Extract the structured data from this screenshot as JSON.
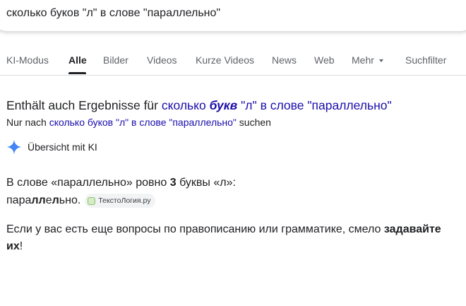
{
  "search": {
    "query": "сколько буков \"л\" в слове \"параллельно\""
  },
  "tabs": {
    "ki_modus": "KI-Modus",
    "alle": "Alle",
    "bilder": "Bilder",
    "videos": "Videos",
    "kurze_videos": "Kurze Videos",
    "news": "News",
    "web": "Web",
    "mehr": "Mehr",
    "suchfilter": "Suchfilter"
  },
  "correction": {
    "prefix": "Enthält auch Ergebnisse für",
    "link_part1": "сколько",
    "link_bold": "букв",
    "link_part2": "\"л\" в слове \"параллельно\"",
    "only_prefix": "Nur nach",
    "only_link": "сколько буков \"л\" в слове \"параллельно\"",
    "only_suffix": "suchen"
  },
  "ai_overview": {
    "label": "Übersicht mit KI",
    "line1_pre": "В слове «параллельно» ровно",
    "line1_count": "3",
    "line1_post": "буквы «л»:",
    "word_a": "пара",
    "word_b": "лл",
    "word_c": "е",
    "word_d": "л",
    "word_e": "ьно.",
    "source": "ТекстоЛогия.ру",
    "line3_pre": "Если у вас есть еще вопросы по правописанию или грамматике, смело",
    "line3_bold": "задавайте их",
    "line3_post": "!"
  },
  "colors": {
    "link": "#1a0dab",
    "text": "#202124",
    "muted": "#5f6368",
    "ai_star": "#4285f4"
  }
}
